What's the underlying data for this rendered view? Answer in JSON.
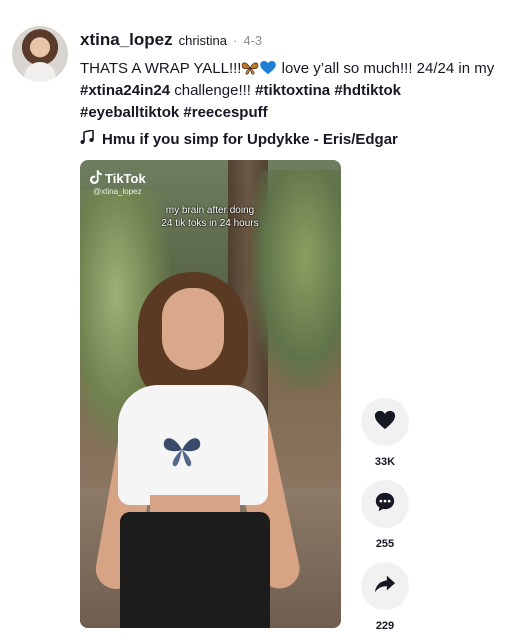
{
  "post": {
    "username": "xtina_lopez",
    "nickname": "christina",
    "separator": "·",
    "date": "4-3",
    "caption_text": "THATS A WRAP YALL!!!",
    "caption_emojis": [
      "butterfly-emoji",
      "blue-heart-emoji"
    ],
    "caption_text_2": " love y’all so much!!! 24/24 in my ",
    "hashtags": [
      "#xtina24in24",
      "#tiktoxtina",
      "#hdtiktok",
      "#eyeballtiktok",
      "#reecespuff"
    ],
    "caption_mid": " challenge!!! ",
    "music": "Hmu if you simp for Updykke - Eris/Edgar"
  },
  "video": {
    "watermark_logo": "TikTok",
    "watermark_handle": "@xtina_lopez",
    "overlay_line1": "my brain after doing",
    "overlay_line2": "24 tik toks in 24 hours"
  },
  "actions": {
    "likes": "33K",
    "comments": "255",
    "shares": "229",
    "icons": [
      "heart-icon",
      "comment-icon",
      "share-icon"
    ]
  },
  "colors": {
    "text_primary": "#161823",
    "text_secondary": "#8a8b91",
    "action_bg": "#f1f1f2",
    "butterfly": "#c4762a",
    "blue_heart": "#1e7fd6"
  }
}
